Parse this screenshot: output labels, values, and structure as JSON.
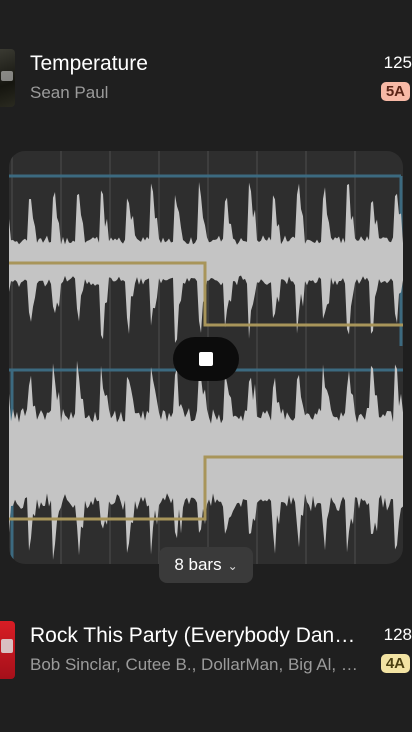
{
  "tracks": [
    {
      "title": "Temperature",
      "artist": "Sean Paul",
      "bpm": "125",
      "key": "5A",
      "key_color": "#f7b9a6"
    },
    {
      "title": "Rock This Party (Everybody Dance Now)",
      "artist": "Bob Sinclar, Cutee B., DollarMan, Big Al, Ozmosis",
      "bpm": "128",
      "key": "4A",
      "key_color": "#f2e3a3"
    }
  ],
  "player": {
    "state": "playing",
    "stop_icon": "stop-icon",
    "loop_length_label": "8 bars",
    "loop_length_icon": "chevron-down-icon"
  },
  "colors": {
    "waveform": "#c4c4c4",
    "beat_grid": "#3e3e3e",
    "blue_envelope": "#3c6a80",
    "yellow_envelope": "#a8955a"
  }
}
